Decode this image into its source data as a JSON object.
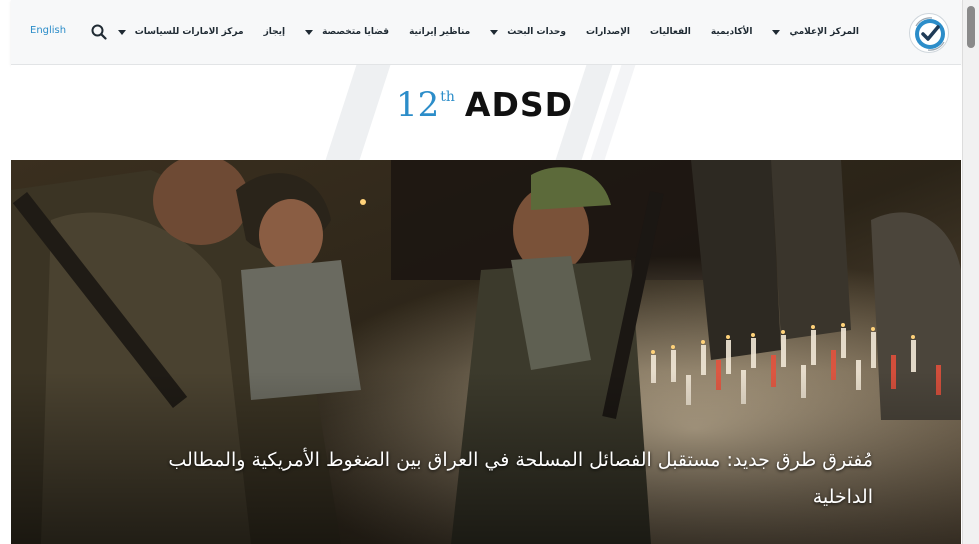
{
  "header": {
    "language_link": "English",
    "nav": [
      {
        "label": "مركز الامارات للسياسات",
        "has_dropdown": true
      },
      {
        "label": "إيجاز",
        "has_dropdown": false
      },
      {
        "label": "قضايا متخصصة",
        "has_dropdown": true
      },
      {
        "label": "مناظير إيرانية",
        "has_dropdown": false
      },
      {
        "label": "وحدات البحث",
        "has_dropdown": true
      },
      {
        "label": "الإصدارات",
        "has_dropdown": false
      },
      {
        "label": "الفعاليات",
        "has_dropdown": false
      },
      {
        "label": "الأكاديمية",
        "has_dropdown": false
      },
      {
        "label": "المركز الإعلامي",
        "has_dropdown": true
      }
    ],
    "icons": {
      "search": "search-icon",
      "logo": "eps-logo-icon"
    }
  },
  "banner": {
    "number": "12",
    "suffix": "th",
    "text": "ADSD"
  },
  "hero": {
    "title": "مُفترق طرق جديد: مستقبل الفصائل المسلحة في العراق بين الضغوط الأمريكية والمطالب الداخلية"
  },
  "colors": {
    "accent": "#2c8dc9",
    "nav_bg": "#f7f8f9",
    "nav_text": "#1f2a33"
  }
}
